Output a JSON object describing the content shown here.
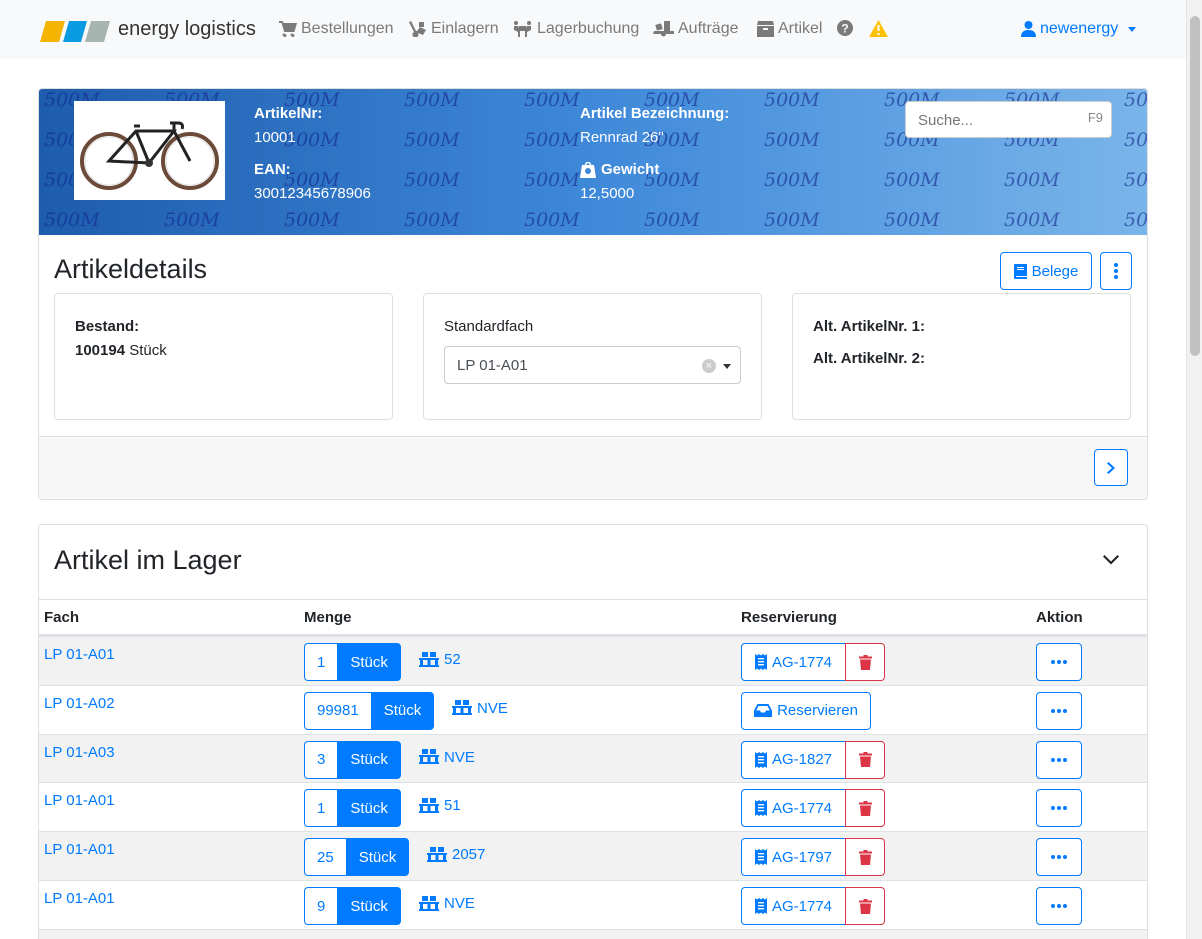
{
  "nav": {
    "brand": "energy logistics",
    "items": [
      {
        "label": "Bestellungen",
        "icon": "cart-icon"
      },
      {
        "label": "Einlagern",
        "icon": "dolly-icon"
      },
      {
        "label": "Lagerbuchung",
        "icon": "people-carry-icon"
      },
      {
        "label": "Aufträge",
        "icon": "truck-loading-icon"
      },
      {
        "label": "Artikel",
        "icon": "boxes-icon"
      }
    ],
    "user": "newenergy"
  },
  "article": {
    "nr_label": "ArtikelNr:",
    "nr": "10001",
    "ean_label": "EAN:",
    "ean": "30012345678906",
    "name_label": "Artikel Bezeichnung:",
    "name": "Rennrad 26\"",
    "weight_label": "Gewicht",
    "weight": "12,5000",
    "watermark": "500M"
  },
  "search": {
    "placeholder": "Suche...",
    "shortcut": "F9"
  },
  "details": {
    "title": "Artikeldetails",
    "belege": "Belege",
    "bestand_label": "Bestand:",
    "bestand_value": "100194",
    "bestand_unit": "Stück",
    "standardfach_label": "Standardfach",
    "standardfach_value": "LP 01-A01",
    "alt1": "Alt. ArtikelNr. 1:",
    "alt2": "Alt. ArtikelNr. 2:"
  },
  "stock": {
    "title": "Artikel im Lager",
    "columns": [
      "Fach",
      "Menge",
      "Reservierung",
      "Aktion"
    ],
    "rows": [
      {
        "fach": "LP 01-A01",
        "qty": "1",
        "unit": "Stück",
        "nve": "52",
        "reservation": "AG-1774"
      },
      {
        "fach": "LP 01-A02",
        "qty": "99981",
        "unit": "Stück",
        "nve": "NVE",
        "reservation": "",
        "reserve_label": "Reservieren"
      },
      {
        "fach": "LP 01-A03",
        "qty": "3",
        "unit": "Stück",
        "nve": "NVE",
        "reservation": "AG-1827"
      },
      {
        "fach": "LP 01-A01",
        "qty": "1",
        "unit": "Stück",
        "nve": "51",
        "reservation": "AG-1774"
      },
      {
        "fach": "LP 01-A01",
        "qty": "25",
        "unit": "Stück",
        "nve": "2057",
        "reservation": "AG-1797"
      },
      {
        "fach": "LP 01-A01",
        "qty": "9",
        "unit": "Stück",
        "nve": "NVE",
        "reservation": "AG-1774"
      }
    ]
  }
}
